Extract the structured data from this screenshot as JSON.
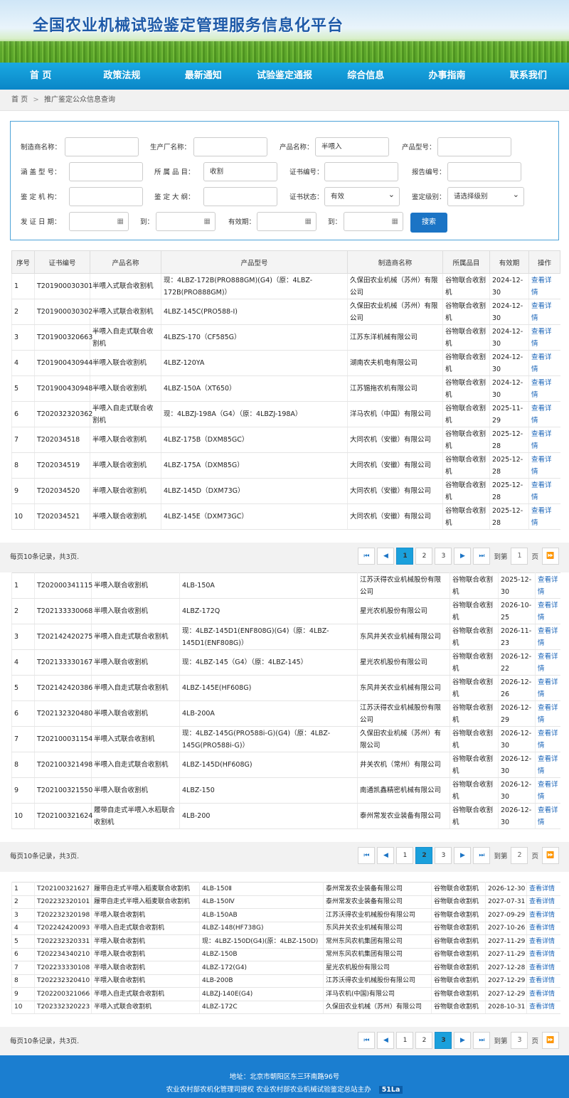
{
  "site_title": "全国农业机械试验鉴定管理服务信息化平台",
  "nav": [
    "首 页",
    "政策法规",
    "最新通知",
    "试验鉴定通报",
    "综合信息",
    "办事指南",
    "联系我们"
  ],
  "breadcrumb": {
    "home": "首 页",
    "sep": ">",
    "current": "推广鉴定公众信息查询"
  },
  "form": {
    "manufacturer_label": "制造商名称：",
    "manufacturer_value": "",
    "producer_label": "生产厂名称：",
    "producer_value": "",
    "product_name_label": "产品名称：",
    "product_name_value": "半喂入",
    "product_model_label": "产品型号：",
    "product_model_value": "",
    "covered_model_label": "涵 盖 型 号：",
    "covered_model_value": "",
    "category_label": "所 属 品 目：",
    "category_value": "收割",
    "cert_no_label": "证书编号：",
    "cert_no_value": "",
    "report_no_label": "报告编号：",
    "report_no_value": "",
    "agency_label": "鉴 定 机 构：",
    "agency_value": "",
    "outline_label": "鉴 定 大 纲：",
    "outline_value": "",
    "cert_status_label": "证书状态：",
    "cert_status_value": "有效",
    "level_label": "鉴定级别：",
    "level_value": "请选择级别",
    "issue_date_label": "发 证 日 期：",
    "to_label": "到：",
    "valid_label": "有效期：",
    "to_label2": "到：",
    "search_button": "搜索"
  },
  "table_headers": [
    "序号",
    "证书编号",
    "产品名称",
    "产品型号",
    "制造商名称",
    "所属品目",
    "有效期",
    "操作"
  ],
  "detail_link": "查看详情",
  "page1": [
    {
      "no": "1",
      "cert": "T201900030301",
      "name": "半喂入式联合收割机",
      "model": "现：4LBZ-172B(PRO888GM)(G4)（原：4LBZ-172B(PRO888GM)）",
      "maker": "久保田农业机械（苏州）有限公司",
      "cat": "谷物联合收割机",
      "valid": "2024-12-30"
    },
    {
      "no": "2",
      "cert": "T201900030302",
      "name": "半喂入式联合收割机",
      "model": "4LBZ-145C(PRO588-I)",
      "maker": "久保田农业机械（苏州）有限公司",
      "cat": "谷物联合收割机",
      "valid": "2024-12-30"
    },
    {
      "no": "3",
      "cert": "T201900320663",
      "name": "半喂入自走式联合收割机",
      "model": "4LBZS-170（CF585G）",
      "maker": "江苏东洋机械有限公司",
      "cat": "谷物联合收割机",
      "valid": "2024-12-30"
    },
    {
      "no": "4",
      "cert": "T201900430944",
      "name": "半喂入联合收割机",
      "model": "4LBZ-120YA",
      "maker": "湖南农夫机电有限公司",
      "cat": "谷物联合收割机",
      "valid": "2024-12-30"
    },
    {
      "no": "5",
      "cert": "T201900430948",
      "name": "半喂入联合收割机",
      "model": "4LBZ-150A（XT650）",
      "maker": "江苏锡拖农机有限公司",
      "cat": "谷物联合收割机",
      "valid": "2024-12-30"
    },
    {
      "no": "6",
      "cert": "T202032320362",
      "name": "半喂入自走式联合收割机",
      "model": "现：4LBZJ-198A（G4）（原：4LBZJ-198A）",
      "maker": "洋马农机（中国）有限公司",
      "cat": "谷物联合收割机",
      "valid": "2025-11-29"
    },
    {
      "no": "7",
      "cert": "T202034518",
      "name": "半喂入联合收割机",
      "model": "4LBZ-175B（DXM85GC）",
      "maker": "大同农机（安徽）有限公司",
      "cat": "谷物联合收割机",
      "valid": "2025-12-28"
    },
    {
      "no": "8",
      "cert": "T202034519",
      "name": "半喂入联合收割机",
      "model": "4LBZ-175A（DXM85G）",
      "maker": "大同农机（安徽）有限公司",
      "cat": "谷物联合收割机",
      "valid": "2025-12-28"
    },
    {
      "no": "9",
      "cert": "T202034520",
      "name": "半喂入联合收割机",
      "model": "4LBZ-145D（DXM73G）",
      "maker": "大同农机（安徽）有限公司",
      "cat": "谷物联合收割机",
      "valid": "2025-12-28"
    },
    {
      "no": "10",
      "cert": "T202034521",
      "name": "半喂入联合收割机",
      "model": "4LBZ-145E（DXM73GC）",
      "maker": "大同农机（安徽）有限公司",
      "cat": "谷物联合收割机",
      "valid": "2025-12-28"
    }
  ],
  "page2": [
    {
      "no": "1",
      "cert": "T202000341115",
      "name": "半喂入联合收割机",
      "model": "4LB-150A",
      "maker": "江苏沃得农业机械股份有限公司",
      "cat": "谷物联合收割机",
      "valid": "2025-12-30"
    },
    {
      "no": "2",
      "cert": "T202133330068",
      "name": "半喂入联合收割机",
      "model": "4LBZ-172Q",
      "maker": "星光农机股份有限公司",
      "cat": "谷物联合收割机",
      "valid": "2026-10-25"
    },
    {
      "no": "3",
      "cert": "T202142420275",
      "name": "半喂入自走式联合收割机",
      "model": "现：4LBZ-145D1(ENF808G)(G4)（原：4LBZ-145D1(ENF808G)）",
      "maker": "东风井关农业机械有限公司",
      "cat": "谷物联合收割机",
      "valid": "2026-11-23"
    },
    {
      "no": "4",
      "cert": "T202133330167",
      "name": "半喂入联合收割机",
      "model": "现：4LBZ-145（G4）（原：4LBZ-145）",
      "maker": "星光农机股份有限公司",
      "cat": "谷物联合收割机",
      "valid": "2026-12-22"
    },
    {
      "no": "5",
      "cert": "T202142420386",
      "name": "半喂入自走式联合收割机",
      "model": "4LBZ-145E(HF608G)",
      "maker": "东风井关农业机械有限公司",
      "cat": "谷物联合收割机",
      "valid": "2026-12-26"
    },
    {
      "no": "6",
      "cert": "T202132320480",
      "name": "半喂入联合收割机",
      "model": "4LB-200A",
      "maker": "江苏沃得农业机械股份有限公司",
      "cat": "谷物联合收割机",
      "valid": "2026-12-29"
    },
    {
      "no": "7",
      "cert": "T202100031154",
      "name": "半喂入式联合收割机",
      "model": "现：4LBZ-145G(PRO588i-G)(G4)（原：4LBZ-145G(PRO588i-G)）",
      "maker": "久保田农业机械（苏州）有限公司",
      "cat": "谷物联合收割机",
      "valid": "2026-12-30"
    },
    {
      "no": "8",
      "cert": "T202100321498",
      "name": "半喂入自走式联合收割机",
      "model": "4LBZ-145D(HF608G)",
      "maker": "井关农机（常州）有限公司",
      "cat": "谷物联合收割机",
      "valid": "2026-12-30"
    },
    {
      "no": "9",
      "cert": "T202100321550",
      "name": "半喂入联合收割机",
      "model": "4LBZ-150",
      "maker": "南通凯鑫精密机械有限公司",
      "cat": "谷物联合收割机",
      "valid": "2026-12-30"
    },
    {
      "no": "10",
      "cert": "T202100321624",
      "name": "履带自走式半喂入水稻联合收割机",
      "model": "4LB-200",
      "maker": "泰州常发农业装备有限公司",
      "cat": "谷物联合收割机",
      "valid": "2026-12-30"
    }
  ],
  "page3": [
    {
      "no": "1",
      "cert": "T202100321627",
      "name": "履带自走式半喂入稻麦联合收割机",
      "model": "4LB-150Ⅱ",
      "maker": "泰州常发农业装备有限公司",
      "cat": "谷物联合收割机",
      "valid": "2026-12-30"
    },
    {
      "no": "2",
      "cert": "T202232320101",
      "name": "履带自走式半喂入稻麦联合收割机",
      "model": "4LB-150Ⅳ",
      "maker": "泰州常发农业装备有限公司",
      "cat": "谷物联合收割机",
      "valid": "2027-07-31"
    },
    {
      "no": "3",
      "cert": "T202232320198",
      "name": "半喂入联合收割机",
      "model": "4LB-150AB",
      "maker": "江苏沃得农业机械股份有限公司",
      "cat": "谷物联合收割机",
      "valid": "2027-09-29"
    },
    {
      "no": "4",
      "cert": "T202242420093",
      "name": "半喂入自走式联合收割机",
      "model": "4LBZ-148(HF738G)",
      "maker": "东风井关农业机械有限公司",
      "cat": "谷物联合收割机",
      "valid": "2027-10-26"
    },
    {
      "no": "5",
      "cert": "T202232320331",
      "name": "半喂入联合收割机",
      "model": "现：4LBZ-150D(G4)(原：4LBZ-150D)",
      "maker": "常州东风农机集团有限公司",
      "cat": "谷物联合收割机",
      "valid": "2027-11-29"
    },
    {
      "no": "6",
      "cert": "T202234340210",
      "name": "半喂入联合收割机",
      "model": "4LBZ-150B",
      "maker": "常州东风农机集团有限公司",
      "cat": "谷物联合收割机",
      "valid": "2027-11-29"
    },
    {
      "no": "7",
      "cert": "T202233330108",
      "name": "半喂入联合收割机",
      "model": "4LBZ-172(G4)",
      "maker": "星光农机股份有限公司",
      "cat": "谷物联合收割机",
      "valid": "2027-12-28"
    },
    {
      "no": "8",
      "cert": "T202232320410",
      "name": "半喂入联合收割机",
      "model": "4LB-200B",
      "maker": "江苏沃得农业机械股份有限公司",
      "cat": "谷物联合收割机",
      "valid": "2027-12-29"
    },
    {
      "no": "9",
      "cert": "T202200321066",
      "name": "半喂入自走式联合收割机",
      "model": "4LBZJ-140E(G4)",
      "maker": "洋马农机(中国)有限公司",
      "cat": "谷物联合收割机",
      "valid": "2027-12-29"
    },
    {
      "no": "10",
      "cert": "T202332320223",
      "name": "半喂入式联合收割机",
      "model": "4LBZ-172C",
      "maker": "久保田农业机械（苏州）有限公司",
      "cat": "谷物联合收割机",
      "valid": "2028-10-31"
    }
  ],
  "pager": {
    "info": "每页10条记录，共3页.",
    "pages": [
      "1",
      "2",
      "3"
    ],
    "goto_label": "到第",
    "page_unit": "页",
    "first_icon": "⏮",
    "prev_icon": "◀",
    "next_icon": "▶",
    "last_icon": "⏭",
    "go_icon": "⏩",
    "current": [
      1,
      2,
      3
    ]
  },
  "footer": {
    "address": "地址：北京市朝阳区东三环南路96号",
    "line2": "农业农村部农机化管理司授权    农业农村部农业机械试验鉴定总站主办",
    "badge": "51La"
  }
}
